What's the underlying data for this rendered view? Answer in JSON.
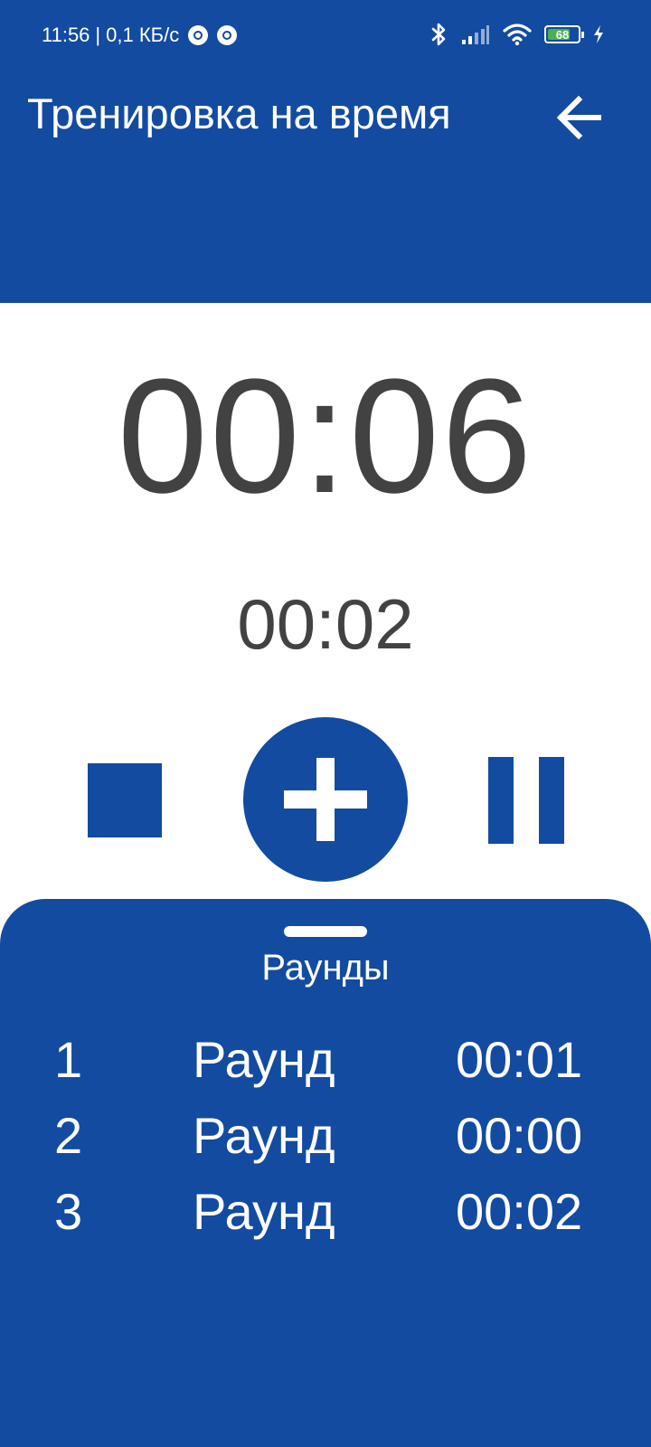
{
  "status_bar": {
    "time": "11:56",
    "separator": "|",
    "network_speed": "0,1 КБ/с",
    "battery_level": "68",
    "icons": [
      "notification-icon",
      "notification-icon",
      "bluetooth-icon",
      "signal-icon",
      "wifi-icon",
      "battery-icon",
      "charging-icon"
    ]
  },
  "header": {
    "title": "Тренировка на время",
    "back_icon": "arrow-left-icon"
  },
  "timer": {
    "main": "00:06",
    "lap": "00:02"
  },
  "controls": {
    "stop_icon": "stop-icon",
    "add_icon": "plus-icon",
    "pause_icon": "pause-icon"
  },
  "rounds_panel": {
    "title": "Раунды",
    "rounds": [
      {
        "number": "1",
        "label": "Раунд",
        "time": "00:01"
      },
      {
        "number": "2",
        "label": "Раунд",
        "time": "00:00"
      },
      {
        "number": "3",
        "label": "Раунд",
        "time": "00:02"
      }
    ]
  },
  "colors": {
    "primary": "#134ba1",
    "text_dark": "#424242",
    "on_primary": "#ffffff",
    "battery": "#4caf50"
  }
}
